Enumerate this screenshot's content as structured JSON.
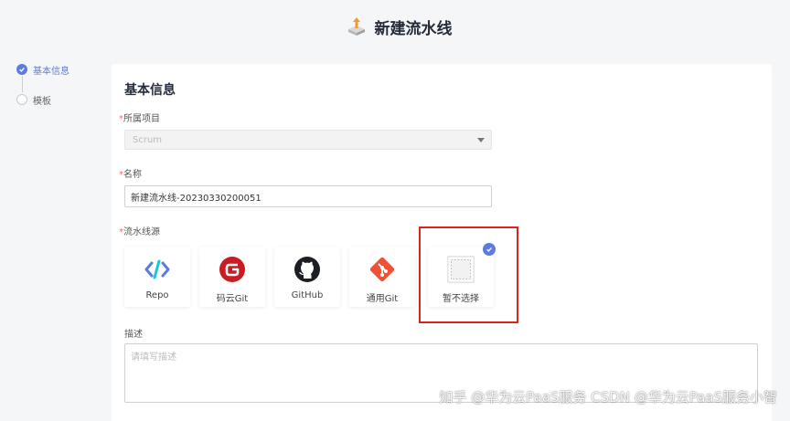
{
  "header": {
    "title": "新建流水线",
    "icon": "pipeline-box-icon"
  },
  "steps": [
    {
      "label": "基本信息",
      "state": "active"
    },
    {
      "label": "模板",
      "state": "inactive"
    }
  ],
  "form": {
    "section_title": "基本信息",
    "project": {
      "required_mark": "*",
      "label": "所属项目",
      "value": "Scrum"
    },
    "name": {
      "required_mark": "*",
      "label": "名称",
      "value": "新建流水线-20230330200051"
    },
    "source": {
      "required_mark": "*",
      "label": "流水线源",
      "options": [
        {
          "label": "Repo",
          "icon": "repo-icon"
        },
        {
          "label": "码云Git",
          "icon": "gitee-icon"
        },
        {
          "label": "GitHub",
          "icon": "github-icon"
        },
        {
          "label": "通用Git",
          "icon": "git-icon"
        },
        {
          "label": "暂不选择",
          "icon": "none-select-icon",
          "selected": true
        }
      ]
    },
    "description": {
      "label": "描述",
      "placeholder": "请填写描述"
    }
  },
  "colors": {
    "accent": "#5e7ce0",
    "highlight": "#d9251c",
    "required": "#f66f6a"
  },
  "watermark": "知乎 @华为云PaaS服务 CSDN @华为云PaaS服务小智"
}
